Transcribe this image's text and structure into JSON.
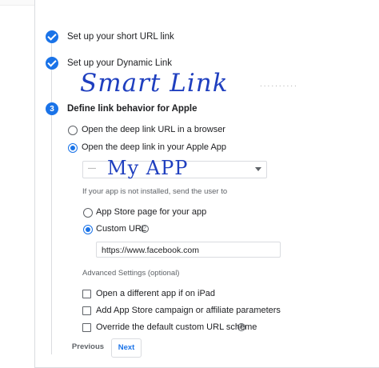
{
  "steps": [
    {
      "number": "",
      "title": "Set up your short URL link",
      "status": "done"
    },
    {
      "number": "",
      "title": "Set up your Dynamic Link",
      "status": "done"
    },
    {
      "number": "3",
      "title": "Define link behavior for Apple",
      "status": "active"
    }
  ],
  "dynamic_link_handwriting": "Smart Link",
  "dynamic_link_dots": "..........",
  "behavior": {
    "option_browser": "Open the deep link URL in a browser",
    "option_app": "Open the deep link in your Apple App",
    "app_select_value": "My APP",
    "app_select_dash": "—",
    "not_installed_hint": "If your app is not installed, send the user to",
    "option_app_store": "App Store page for your app",
    "option_custom_url": "Custom URL",
    "custom_url_value": "https://www.facebook.com"
  },
  "advanced": {
    "title": "Advanced Settings (optional)",
    "items": [
      "Open a different app if on iPad",
      "Add App Store campaign or affiliate parameters",
      "Override the default custom URL scheme"
    ]
  },
  "buttons": {
    "previous": "Previous",
    "next": "Next"
  },
  "colors": {
    "accent": "#1a73e8",
    "handwriting": "#1f3fbf"
  }
}
